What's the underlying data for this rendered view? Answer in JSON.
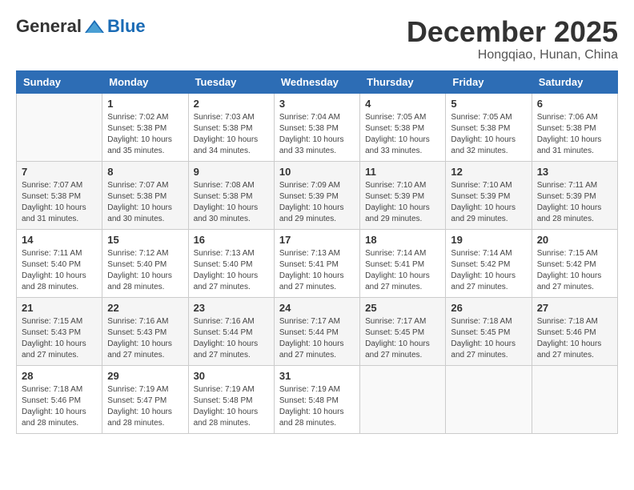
{
  "logo": {
    "general": "General",
    "blue": "Blue"
  },
  "header": {
    "month": "December 2025",
    "location": "Hongqiao, Hunan, China"
  },
  "weekdays": [
    "Sunday",
    "Monday",
    "Tuesday",
    "Wednesday",
    "Thursday",
    "Friday",
    "Saturday"
  ],
  "weeks": [
    [
      {
        "day": "",
        "info": ""
      },
      {
        "day": "1",
        "info": "Sunrise: 7:02 AM\nSunset: 5:38 PM\nDaylight: 10 hours\nand 35 minutes."
      },
      {
        "day": "2",
        "info": "Sunrise: 7:03 AM\nSunset: 5:38 PM\nDaylight: 10 hours\nand 34 minutes."
      },
      {
        "day": "3",
        "info": "Sunrise: 7:04 AM\nSunset: 5:38 PM\nDaylight: 10 hours\nand 33 minutes."
      },
      {
        "day": "4",
        "info": "Sunrise: 7:05 AM\nSunset: 5:38 PM\nDaylight: 10 hours\nand 33 minutes."
      },
      {
        "day": "5",
        "info": "Sunrise: 7:05 AM\nSunset: 5:38 PM\nDaylight: 10 hours\nand 32 minutes."
      },
      {
        "day": "6",
        "info": "Sunrise: 7:06 AM\nSunset: 5:38 PM\nDaylight: 10 hours\nand 31 minutes."
      }
    ],
    [
      {
        "day": "7",
        "info": "Sunrise: 7:07 AM\nSunset: 5:38 PM\nDaylight: 10 hours\nand 31 minutes."
      },
      {
        "day": "8",
        "info": "Sunrise: 7:07 AM\nSunset: 5:38 PM\nDaylight: 10 hours\nand 30 minutes."
      },
      {
        "day": "9",
        "info": "Sunrise: 7:08 AM\nSunset: 5:38 PM\nDaylight: 10 hours\nand 30 minutes."
      },
      {
        "day": "10",
        "info": "Sunrise: 7:09 AM\nSunset: 5:39 PM\nDaylight: 10 hours\nand 29 minutes."
      },
      {
        "day": "11",
        "info": "Sunrise: 7:10 AM\nSunset: 5:39 PM\nDaylight: 10 hours\nand 29 minutes."
      },
      {
        "day": "12",
        "info": "Sunrise: 7:10 AM\nSunset: 5:39 PM\nDaylight: 10 hours\nand 29 minutes."
      },
      {
        "day": "13",
        "info": "Sunrise: 7:11 AM\nSunset: 5:39 PM\nDaylight: 10 hours\nand 28 minutes."
      }
    ],
    [
      {
        "day": "14",
        "info": "Sunrise: 7:11 AM\nSunset: 5:40 PM\nDaylight: 10 hours\nand 28 minutes."
      },
      {
        "day": "15",
        "info": "Sunrise: 7:12 AM\nSunset: 5:40 PM\nDaylight: 10 hours\nand 28 minutes."
      },
      {
        "day": "16",
        "info": "Sunrise: 7:13 AM\nSunset: 5:40 PM\nDaylight: 10 hours\nand 27 minutes."
      },
      {
        "day": "17",
        "info": "Sunrise: 7:13 AM\nSunset: 5:41 PM\nDaylight: 10 hours\nand 27 minutes."
      },
      {
        "day": "18",
        "info": "Sunrise: 7:14 AM\nSunset: 5:41 PM\nDaylight: 10 hours\nand 27 minutes."
      },
      {
        "day": "19",
        "info": "Sunrise: 7:14 AM\nSunset: 5:42 PM\nDaylight: 10 hours\nand 27 minutes."
      },
      {
        "day": "20",
        "info": "Sunrise: 7:15 AM\nSunset: 5:42 PM\nDaylight: 10 hours\nand 27 minutes."
      }
    ],
    [
      {
        "day": "21",
        "info": "Sunrise: 7:15 AM\nSunset: 5:43 PM\nDaylight: 10 hours\nand 27 minutes."
      },
      {
        "day": "22",
        "info": "Sunrise: 7:16 AM\nSunset: 5:43 PM\nDaylight: 10 hours\nand 27 minutes."
      },
      {
        "day": "23",
        "info": "Sunrise: 7:16 AM\nSunset: 5:44 PM\nDaylight: 10 hours\nand 27 minutes."
      },
      {
        "day": "24",
        "info": "Sunrise: 7:17 AM\nSunset: 5:44 PM\nDaylight: 10 hours\nand 27 minutes."
      },
      {
        "day": "25",
        "info": "Sunrise: 7:17 AM\nSunset: 5:45 PM\nDaylight: 10 hours\nand 27 minutes."
      },
      {
        "day": "26",
        "info": "Sunrise: 7:18 AM\nSunset: 5:45 PM\nDaylight: 10 hours\nand 27 minutes."
      },
      {
        "day": "27",
        "info": "Sunrise: 7:18 AM\nSunset: 5:46 PM\nDaylight: 10 hours\nand 27 minutes."
      }
    ],
    [
      {
        "day": "28",
        "info": "Sunrise: 7:18 AM\nSunset: 5:46 PM\nDaylight: 10 hours\nand 28 minutes."
      },
      {
        "day": "29",
        "info": "Sunrise: 7:19 AM\nSunset: 5:47 PM\nDaylight: 10 hours\nand 28 minutes."
      },
      {
        "day": "30",
        "info": "Sunrise: 7:19 AM\nSunset: 5:48 PM\nDaylight: 10 hours\nand 28 minutes."
      },
      {
        "day": "31",
        "info": "Sunrise: 7:19 AM\nSunset: 5:48 PM\nDaylight: 10 hours\nand 28 minutes."
      },
      {
        "day": "",
        "info": ""
      },
      {
        "day": "",
        "info": ""
      },
      {
        "day": "",
        "info": ""
      }
    ]
  ]
}
